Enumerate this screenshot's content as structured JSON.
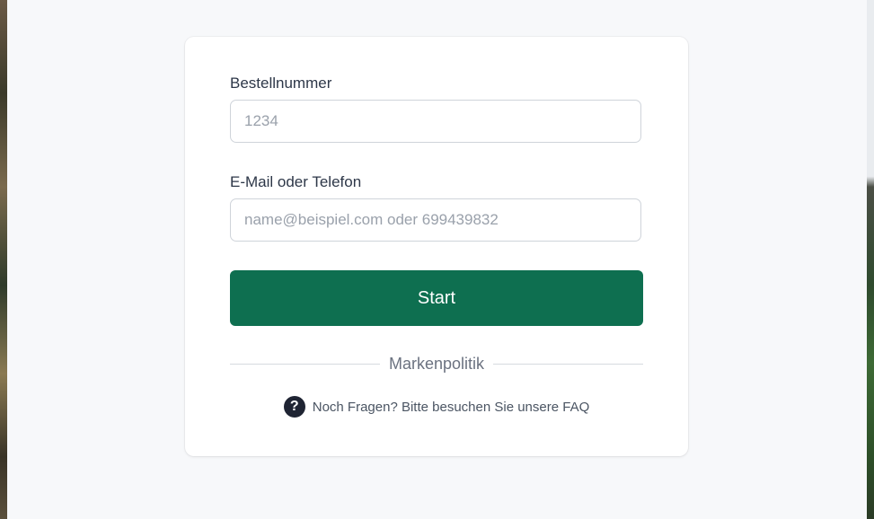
{
  "order_form": {
    "order_number": {
      "label": "Bestellnummer",
      "placeholder": "1234",
      "value": ""
    },
    "contact": {
      "label": "E-Mail oder Telefon",
      "placeholder": "name@beispiel.com oder 699439832",
      "value": ""
    },
    "submit_label": "Start"
  },
  "brand_policy": {
    "label": "Markenpolitik"
  },
  "faq": {
    "icon": "question-circle-icon",
    "icon_glyph": "?",
    "text": "Noch Fragen? Bitte besuchen Sie unsere FAQ"
  },
  "colors": {
    "primary_button": "#0e6f50",
    "page_background": "#f7f8fa",
    "card_background": "#ffffff",
    "faq_icon_background": "#1f2433"
  }
}
